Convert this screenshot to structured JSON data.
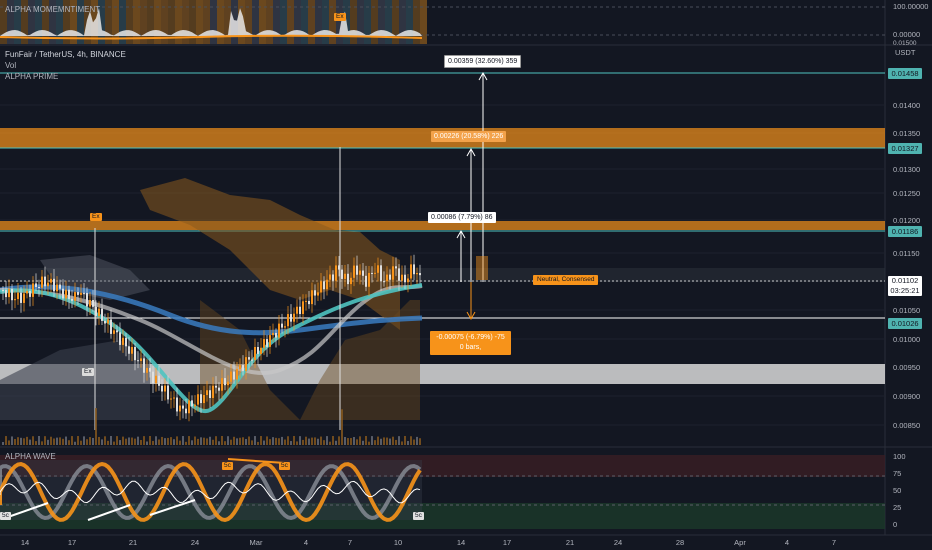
{
  "symbol_header": {
    "top_indicator": "ALPHA MOMEMNTIMENT",
    "symbol": "FunFair / TetherUS, 4h, BINANCE",
    "vol": "Vol",
    "indicator": "ALPHA PRIME",
    "wave_indicator": "ALPHA WAVE"
  },
  "top_axis": {
    "values": [
      "100.00000",
      "0.00000",
      "0.01500"
    ],
    "currency": "USDT"
  },
  "price_axis": {
    "labels": [
      "0.01400",
      "0.01350",
      "0.01300",
      "0.01250",
      "0.01200",
      "0.01150",
      "0.01050",
      "0.01000",
      "0.00950",
      "0.00900",
      "0.00850"
    ],
    "tags": {
      "top_level": "0.01458",
      "upper_level": "0.01327",
      "mid_level": "0.01186",
      "current": "0.01102",
      "countdown": "03:25:21",
      "lower_level": "0.01026"
    }
  },
  "measurements": {
    "m1": "0.00359 (32.60%) 359",
    "m2": "0.00226 (20.58%) 226",
    "m3": "0.00086 (7.79%) 86",
    "m4_line1": "-0.00075 (-6.79%) -75",
    "m4_line2": "0 bars,"
  },
  "markers": {
    "ex_top": "Ex",
    "ex_bottom": "Ex",
    "ex_momentum": "Ex",
    "signal_label": "Neutral, Consensed",
    "wave_left": "5c",
    "wave_top1": "5c",
    "wave_top2": "5c",
    "wave_right": "5c"
  },
  "wave_axis": {
    "labels": [
      "100",
      "75",
      "50",
      "25",
      "0"
    ]
  },
  "time_axis": {
    "labels": [
      "14",
      "17",
      "21",
      "24",
      "Mar",
      "4",
      "7",
      "10",
      "14",
      "17",
      "21",
      "24",
      "28",
      "Apr",
      "4",
      "7"
    ]
  },
  "colors": {
    "background": "#131722",
    "orange": "#f7931a",
    "teal": "#4fc3c0",
    "teal_tag": "#26a69a",
    "blue": "#3a7bbf"
  }
}
